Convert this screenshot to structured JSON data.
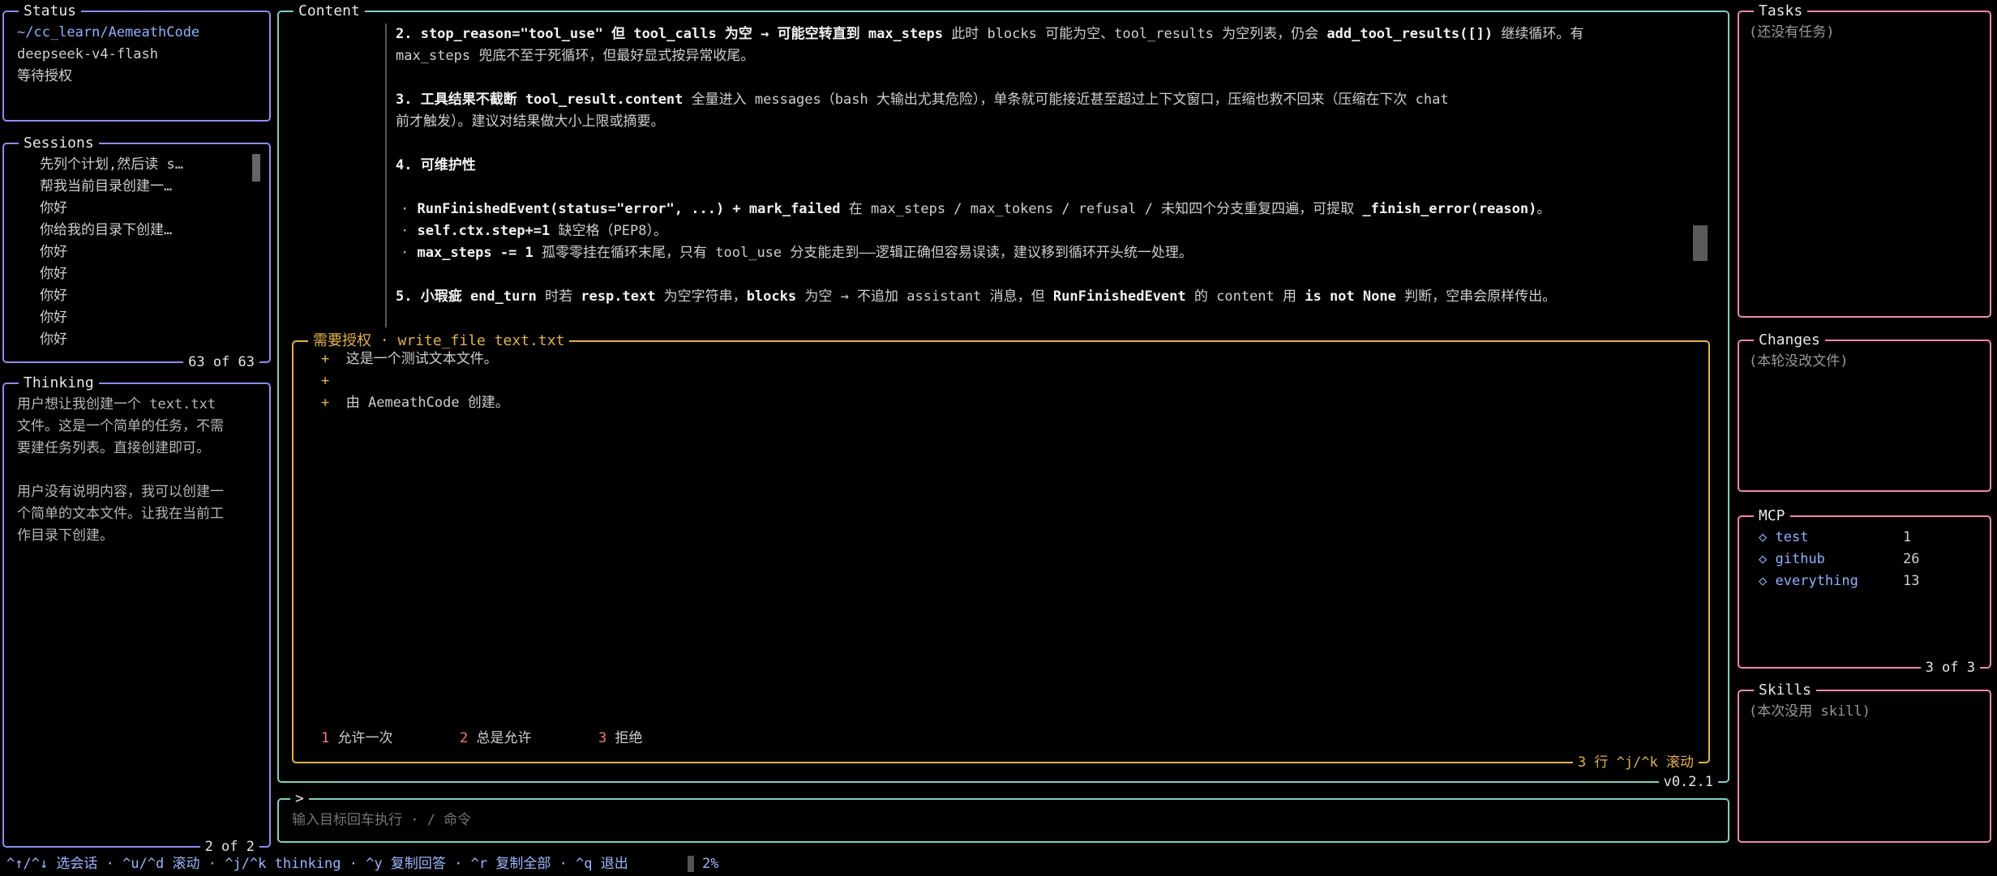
{
  "status": {
    "title": "Status",
    "path": "~/cc_learn/AemeathCode",
    "model": "deepseek-v4-flash",
    "state": "等待授权"
  },
  "sessions": {
    "title": "Sessions",
    "items": [
      "先列个计划,然后读 s…",
      "帮我当前目录创建一…",
      "你好",
      "你给我的目录下创建…",
      "你好",
      "你好",
      "你好",
      "你好",
      "你好"
    ],
    "footer": "63 of 63"
  },
  "thinking": {
    "title": "Thinking",
    "para1": [
      "用户想让我创建一个 text.txt",
      "文件。这是一个简单的任务，不需",
      "要建任务列表。直接创建即可。"
    ],
    "para2": [
      "用户没有说明内容，我可以创建一",
      "个简单的文本文件。让我在当前工",
      "作目录下创建。"
    ],
    "footer": "2 of 2"
  },
  "content": {
    "title": "Content",
    "p2_a": "2. stop_reason=\"tool_use\" 但 tool_calls 为空 → 可能空转直到 max_steps",
    "p2_b": " 此时 blocks 可能为空、tool_results 为空列表，仍会 ",
    "p2_c": "add_tool_results([])",
    "p2_d": " 继续循环。有",
    "p2_e": "max_steps 兜底不至于死循环，但最好显式按异常收尾。",
    "p3_a": "3. 工具结果不截断 tool_result.content",
    "p3_b": " 全量进入 messages（bash 大输出尤其危险），单条就可能接近甚至超过上下文窗口，压缩也救不回来（压缩在下次 chat",
    "p3_c": "前才触发）。建议对结果做大小上限或摘要。",
    "p4": "4. 可维护性",
    "b1_a": "RunFinishedEvent(status=\"error\", ...) + mark_failed",
    "b1_b": " 在 max_steps / max_tokens / refusal / 未知四个分支重复四遍，可提取 ",
    "b1_c": "_finish_error(reason)",
    "b1_d": "。",
    "b2_a": "self.ctx.step+=1",
    "b2_b": " 缺空格（PEP8）。",
    "b3_a": "max_steps -= 1",
    "b3_b": " 孤零零挂在循环末尾，只有 tool_use 分支能走到——逻辑正确但容易误读，建议移到循环开头统一处理。",
    "p5_a": "5. 小瑕疵 end_turn",
    "p5_b": " 时若 ",
    "p5_c": "resp.text",
    "p5_d": " 为空字符串，",
    "p5_e": "blocks",
    "p5_f": " 为空 → 不追加 assistant 消息，但 ",
    "p5_g": "RunFinishedEvent",
    "p5_h": " 的 content 用 ",
    "p5_i": "is not None",
    "p5_j": " 判断，空串会原样传出。",
    "bullet": "·",
    "version": "v0.2.1"
  },
  "auth": {
    "title": "需要授权 · write_file  text.txt",
    "plus": "+",
    "lines": [
      "这是一个测试文本文件。",
      "",
      "由 AemeathCode 创建。"
    ],
    "options": [
      {
        "key": "1",
        "label": "允许一次"
      },
      {
        "key": "2",
        "label": "总是允许"
      },
      {
        "key": "3",
        "label": "拒绝"
      }
    ],
    "footer": "3 行  ^j/^k 滚动"
  },
  "prompt": {
    "caret": ">",
    "placeholder": "输入目标回车执行 · / 命令"
  },
  "tasks": {
    "title": "Tasks",
    "empty": "(还没有任务)"
  },
  "changes": {
    "title": "Changes",
    "empty": "(本轮没改文件)"
  },
  "mcp": {
    "title": "MCP",
    "diamond": "◇",
    "items": [
      {
        "name": "test",
        "count": "1"
      },
      {
        "name": "github",
        "count": "26"
      },
      {
        "name": "everything",
        "count": "13"
      }
    ],
    "footer": "3 of 3"
  },
  "skills": {
    "title": "Skills",
    "empty": "(本次没用 skill)"
  },
  "statusbar": {
    "hints": "^↑/^↓ 选会话 · ^u/^d 滚动 · ^j/^k thinking · ^y 复制回答 · ^r 复制全部 · ^q 退出",
    "progress": "2%"
  },
  "colors": {
    "left_border": "#8b8ff0",
    "content_border": "#7fd1c4",
    "right_border": "#f08aa8",
    "auth_border": "#e3b24a",
    "path": "#8fb0ff",
    "option_key": "#f07f7f",
    "mcp_item": "#8fb0ff"
  }
}
